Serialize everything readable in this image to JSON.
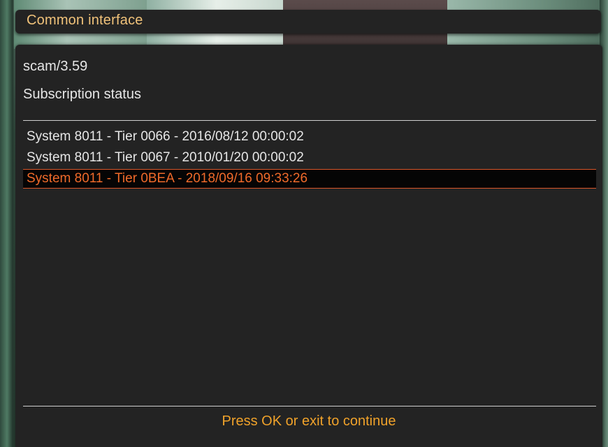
{
  "window": {
    "title": "Common interface"
  },
  "info": {
    "module": "scam/3.59",
    "heading": "Subscription status"
  },
  "subscriptions": {
    "items": [
      {
        "label": "System 8011 - Tier 0066 - 2016/08/12 00:00:02",
        "selected": false
      },
      {
        "label": "System 8011 - Tier 0067 - 2010/01/20 00:00:02",
        "selected": false
      },
      {
        "label": "System 8011 - Tier 0BEA - 2018/09/16 09:33:26",
        "selected": true
      }
    ]
  },
  "footer": {
    "hint": "Press OK or exit to continue"
  },
  "colors": {
    "title_text": "#f0c27a",
    "selected_text": "#f06a2a",
    "selected_border": "#d9572a",
    "footer_text": "#f0a22a",
    "panel_bg": "#232323"
  }
}
